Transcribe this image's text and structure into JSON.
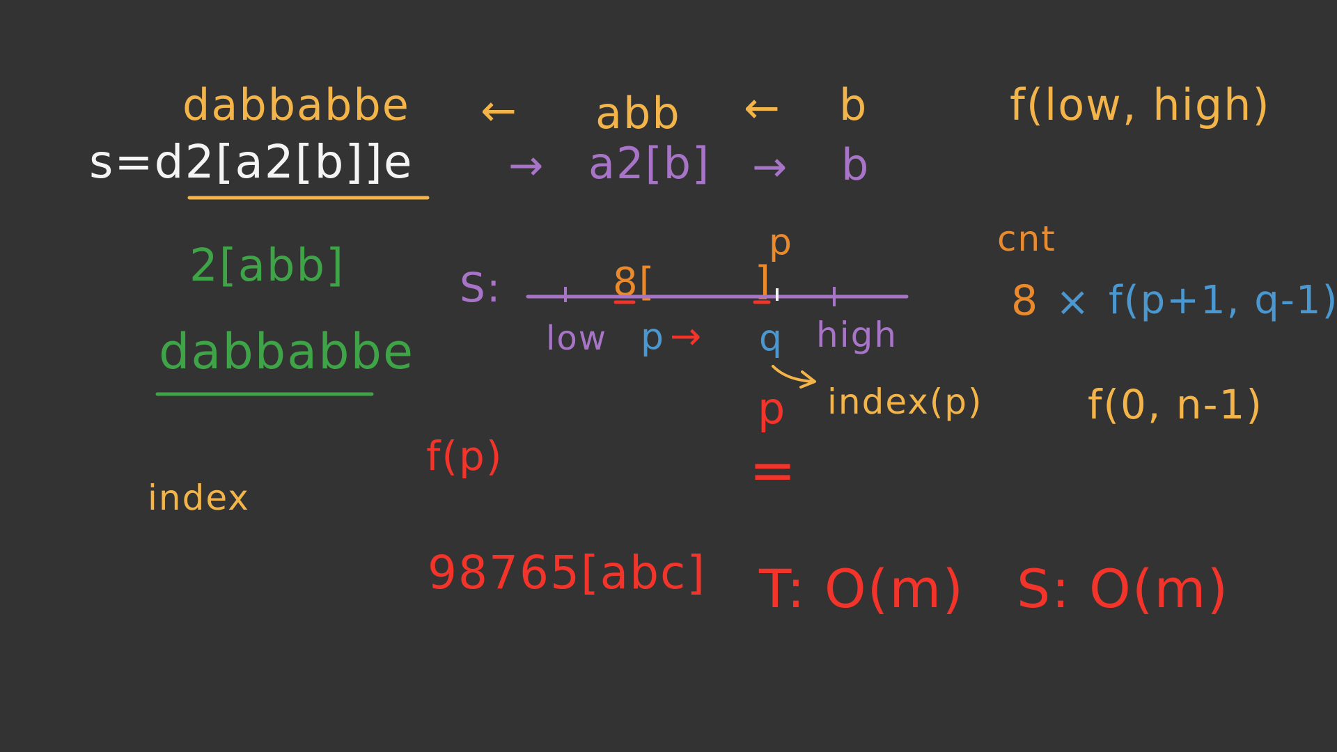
{
  "colors": {
    "background": "#333333",
    "white": "#f4f4f4",
    "yellow": "#f3b54a",
    "orange": "#ea8a2c",
    "purple": "#a874c8",
    "green": "#3fa447",
    "red": "#f2342a",
    "blue": "#4b97cf"
  },
  "top": {
    "decoded_full": "dabbabbe",
    "arrow_left": "←",
    "decoded_mid": "abb",
    "decoded_inner": "b",
    "func": "f(low, high)",
    "encoded_full": "s=d2[a2[b]]e",
    "arrow_right": "→",
    "encoded_mid": "a2[b]",
    "encoded_inner": "b"
  },
  "left": {
    "example_encoded": "2[abb]",
    "example_decoded": "dabbabbe",
    "index_label": "index"
  },
  "diagram": {
    "s_label": "S:",
    "p_top": "p",
    "count_label": "8[",
    "close_bracket": "]",
    "low": "low",
    "p": "p",
    "arrow": "→",
    "q": "q",
    "high": "high",
    "index_p": "index(p)",
    "p_red": "p",
    "equals": "="
  },
  "right": {
    "cnt": "cnt",
    "multiplier": "8",
    "times": "×",
    "recursive_call": "f(p+1, q-1)",
    "initial_call": "f(0, n-1)"
  },
  "bottom": {
    "f_p": "f(p)",
    "big_example": "98765[abc]",
    "time": "T: O(m)",
    "space": "S: O(m)"
  }
}
